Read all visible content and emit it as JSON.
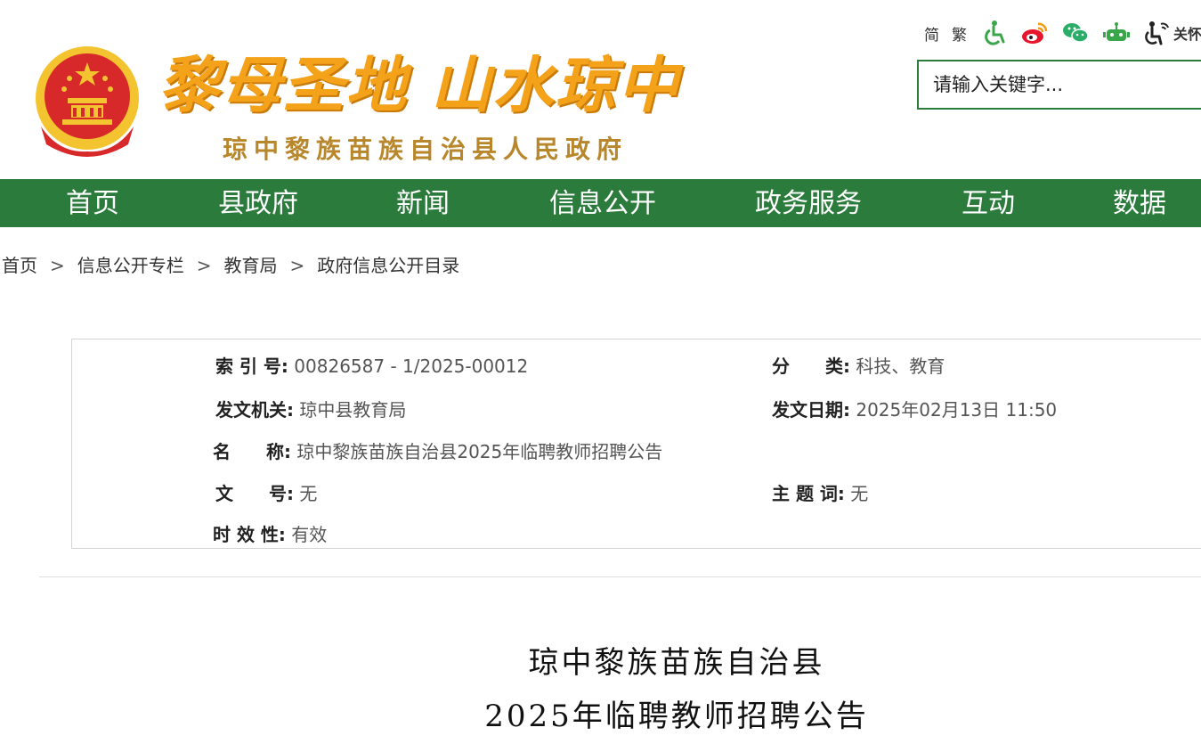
{
  "header": {
    "slogan": "黎母圣地 山水琼中",
    "site_name": "琼中黎族苗族自治县人民政府",
    "tools": {
      "simplified": "简",
      "traditional": "繁",
      "care_mode": "关怀版",
      "icons": [
        "accessibility-icon",
        "weibo-icon",
        "wechat-icon",
        "robot-icon",
        "elder-care-icon"
      ]
    },
    "search": {
      "placeholder": "请输入关键字..."
    }
  },
  "nav": {
    "items": [
      {
        "label": "首页"
      },
      {
        "label": "县政府"
      },
      {
        "label": "新闻"
      },
      {
        "label": "信息公开"
      },
      {
        "label": "政务服务"
      },
      {
        "label": "互动"
      },
      {
        "label": "数据"
      }
    ]
  },
  "breadcrumb": {
    "items": [
      "首页",
      "信息公开专栏",
      "教育局",
      "政府信息公开目录"
    ],
    "separator": ">"
  },
  "info": {
    "index_no": {
      "label": "索 引 号:",
      "value": "00826587 - 1/2025-00012"
    },
    "category": {
      "label": "分　　类:",
      "value": "科技、教育"
    },
    "issuer": {
      "label": "发文机关:",
      "value": "琼中县教育局"
    },
    "issue_date": {
      "label": "发文日期:",
      "value": "2025年02月13日 11:50"
    },
    "name": {
      "label": "名　　称:",
      "value": "琼中黎族苗族自治县2025年临聘教师招聘公告"
    },
    "doc_no": {
      "label": "文　　号:",
      "value": "无"
    },
    "subject": {
      "label": "主 题 词:",
      "value": "无"
    },
    "validity": {
      "label": "时 效 性:",
      "value": "有效"
    }
  },
  "article": {
    "title_line1": "琼中黎族苗族自治县",
    "title_line2": "2025年临聘教师招聘公告"
  },
  "colors": {
    "nav_green": "#2b7b3c",
    "slogan_orange": "#f4a21a",
    "site_name_gold": "#b8862b",
    "emblem_red": "#d7282a",
    "emblem_gold": "#f4c430"
  }
}
